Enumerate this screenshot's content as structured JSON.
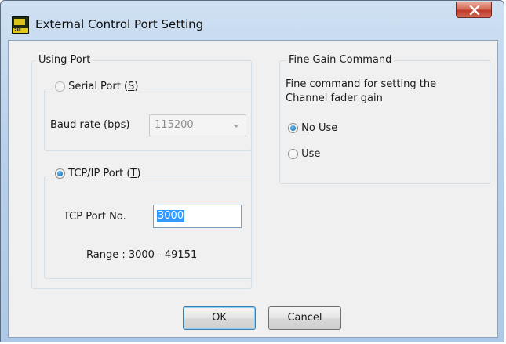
{
  "window": {
    "title": "External Control Port Setting"
  },
  "app_icon": {
    "text": "2ill"
  },
  "using_port": {
    "legend": "Using Port",
    "serial": {
      "label_pre": "Serial Port (",
      "label_key": "S",
      "label_post": ")",
      "checked": false,
      "baud_label": "Baud rate (bps)",
      "baud_value": "115200"
    },
    "tcp": {
      "label_pre": "TCP/IP Port (",
      "label_key": "T",
      "label_post": ")",
      "checked": true,
      "port_label": "TCP Port No.",
      "port_value": "3000",
      "range_text": "Range : 3000 - 49151"
    }
  },
  "fine_gain": {
    "legend": "Fine Gain Command",
    "desc_line1": "Fine command for setting the",
    "desc_line2": "Channel fader gain",
    "no_use": {
      "label_key": "N",
      "label_rest": "o Use",
      "checked": true
    },
    "use": {
      "label_key": "U",
      "label_rest": "se",
      "checked": false
    }
  },
  "buttons": {
    "ok": "OK",
    "cancel": "Cancel"
  },
  "colors": {
    "close_button": "#c0392b",
    "accent": "#3399ff"
  }
}
